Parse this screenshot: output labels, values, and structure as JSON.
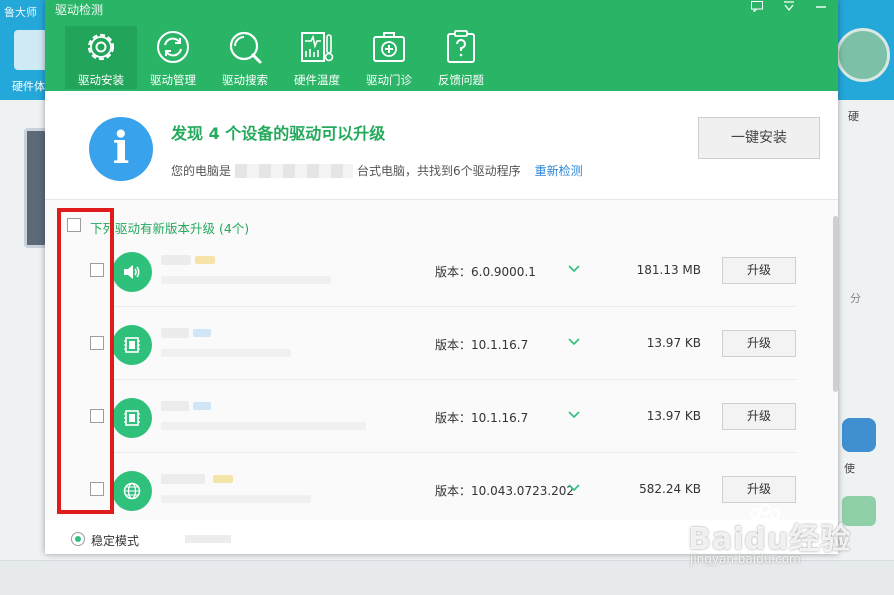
{
  "background": {
    "app_title": "鲁大师",
    "left_label": "硬件体",
    "right_label_1": "硬",
    "right_label_2": "分",
    "right_label_3": "使"
  },
  "dialog": {
    "title": "驱动检测",
    "window_controls": [
      "message-icon",
      "menu-icon",
      "minimize-icon"
    ],
    "toolbar": [
      {
        "label": "驱动安装",
        "icon": "gear-icon",
        "active": true
      },
      {
        "label": "驱动管理",
        "icon": "refresh-icon",
        "active": false
      },
      {
        "label": "驱动搜索",
        "icon": "search-icon",
        "active": false
      },
      {
        "label": "硬件温度",
        "icon": "thermometer-icon",
        "active": false
      },
      {
        "label": "驱动门诊",
        "icon": "medical-kit-icon",
        "active": false
      },
      {
        "label": "反馈问题",
        "icon": "feedback-icon",
        "active": false
      }
    ],
    "headline": "发现 4 个设备的驱动可以升级",
    "subline_prefix": "您的电脑是",
    "subline_suffix": "台式电脑，共找到6个驱动程序",
    "rescan_link": "重新检测",
    "install_all_button": "一键安装",
    "section_header": "下列驱动有新版本升级 (4个)",
    "drivers": [
      {
        "icon": "speaker-icon",
        "version": "版本：6.0.9000.1",
        "size": "181.13 MB",
        "button": "升级"
      },
      {
        "icon": "chip-icon",
        "version": "版本：10.1.16.7",
        "size": "13.97 KB",
        "button": "升级"
      },
      {
        "icon": "chip-icon",
        "version": "版本：10.1.16.7",
        "size": "13.97 KB",
        "button": "升级"
      },
      {
        "icon": "globe-icon",
        "version": "版本：10.043.0723.202",
        "size": "582.24 KB",
        "button": "升级"
      }
    ],
    "mode_label": "稳定模式"
  },
  "watermark": {
    "text": "Baidu经验",
    "url": "jingyan.baidu.com"
  },
  "colors": {
    "header_green": "#29b466",
    "accent_green": "#24a95d",
    "info_blue": "#38a3ec",
    "highlight_red": "#e01b1b"
  }
}
